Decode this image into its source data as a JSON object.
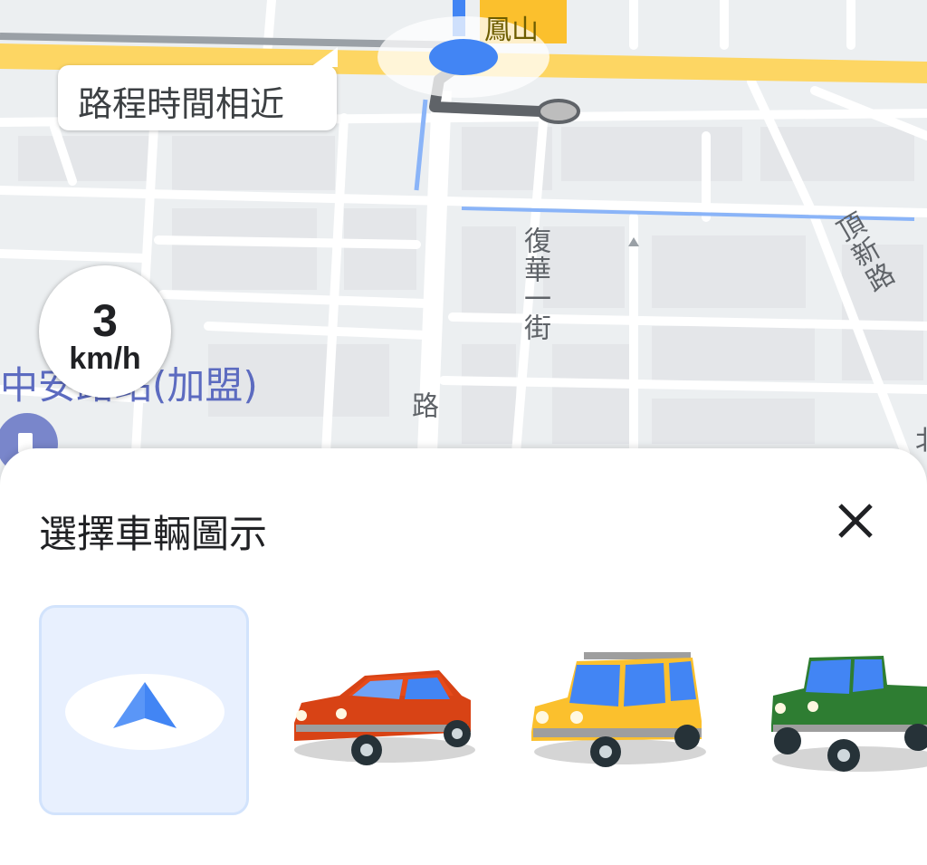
{
  "map": {
    "route_hint": "路程時間相近",
    "speed": {
      "value": "3",
      "unit": "km/h"
    },
    "labels": {
      "road_top": "鳳山",
      "street_fuhua": "復華一街",
      "street_dingxin": "頂新路",
      "street_partial": "路",
      "poi_partial": "中安路站(加盟)",
      "partial_right": "北"
    }
  },
  "sheet": {
    "title": "選擇車輛圖示",
    "vehicles": [
      {
        "id": "navigation-arrow",
        "selected": true
      },
      {
        "id": "red-sedan",
        "selected": false
      },
      {
        "id": "yellow-suv",
        "selected": false
      },
      {
        "id": "green-pickup",
        "selected": false
      }
    ]
  },
  "colors": {
    "route_blue": "#4285f4",
    "highway_yellow": "#fdd663",
    "selected_bg": "#e8f0fe"
  }
}
